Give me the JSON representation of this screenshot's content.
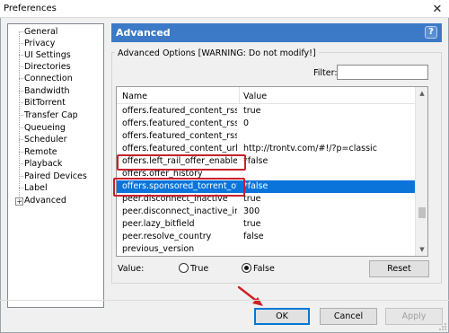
{
  "window": {
    "title": "Preferences",
    "close_glyph": "✕"
  },
  "tree": {
    "items": [
      {
        "label": "General"
      },
      {
        "label": "Privacy"
      },
      {
        "label": "UI Settings"
      },
      {
        "label": "Directories"
      },
      {
        "label": "Connection"
      },
      {
        "label": "Bandwidth"
      },
      {
        "label": "BitTorrent"
      },
      {
        "label": "Transfer Cap"
      },
      {
        "label": "Queueing"
      },
      {
        "label": "Scheduler"
      },
      {
        "label": "Remote"
      },
      {
        "label": "Playback"
      },
      {
        "label": "Paired Devices"
      },
      {
        "label": "Label"
      },
      {
        "label": "Advanced",
        "expander": "+"
      }
    ]
  },
  "panel": {
    "title": "Advanced",
    "help_glyph": "?",
    "group_title": "Advanced Options [WARNING: Do not modify!]",
    "filter_label": "Filter:",
    "filter_value": ""
  },
  "list": {
    "headers": {
      "name": "Name",
      "value": "Value"
    },
    "rows": [
      {
        "name": "offers.featured_content_rss_ra...",
        "value": "true"
      },
      {
        "name": "offers.featured_content_rss_up...",
        "value": "0"
      },
      {
        "name": "offers.featured_content_rss_url",
        "value": ""
      },
      {
        "name": "offers.featured_content_url",
        "value": "http://trontv.com/#!/?p=classic"
      },
      {
        "name": "offers.left_rail_offer_enabled",
        "value": "*false"
      },
      {
        "name": "offers.offer_history",
        "value": ""
      },
      {
        "name": "offers.sponsored_torrent_offer...",
        "value": "*false",
        "selected": true
      },
      {
        "name": "peer.disconnect_inactive",
        "value": "true"
      },
      {
        "name": "peer.disconnect_inactive_inter...",
        "value": "300"
      },
      {
        "name": "peer.lazy_bitfield",
        "value": "true"
      },
      {
        "name": "peer.resolve_country",
        "value": "false"
      },
      {
        "name": "previous_version",
        "value": ""
      }
    ]
  },
  "value_editor": {
    "label": "Value:",
    "true_label": "True",
    "false_label": "False",
    "selected": "False",
    "reset_label": "Reset"
  },
  "footer": {
    "ok_label": "OK",
    "cancel_label": "Cancel",
    "apply_label": "Apply"
  },
  "colors": {
    "header_blue": "#3c7ac7",
    "selection_blue": "#0a74da",
    "highlight_red": "#c8202a"
  },
  "icons": [
    "close-icon",
    "help-icon",
    "tree-expand-icon",
    "scroll-up-icon",
    "scroll-down-icon",
    "red-arrow-icon",
    "resize-grip-icon"
  ]
}
